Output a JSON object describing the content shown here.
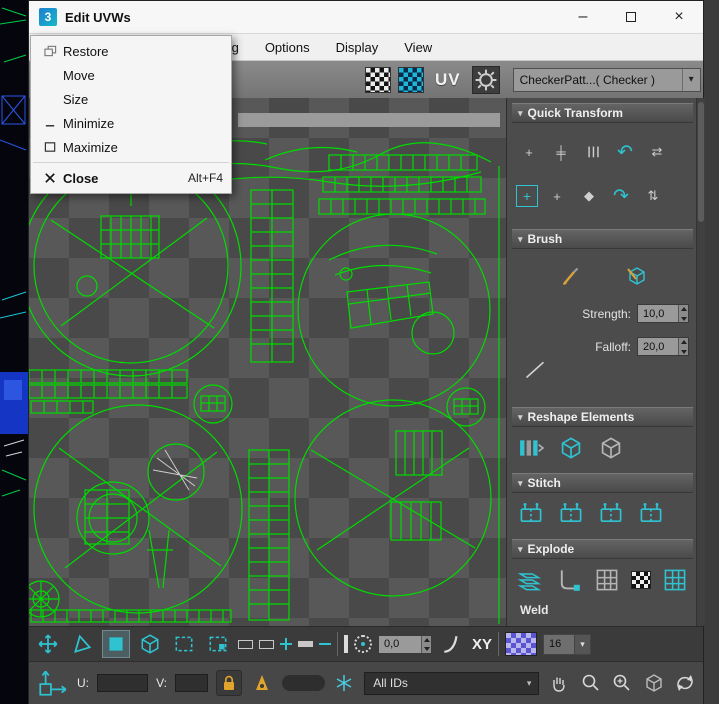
{
  "window": {
    "title": "Edit UVWs",
    "logo_text": "3",
    "controls": {
      "minimize": "–",
      "close": "×"
    },
    "menu_bar": [
      "pping",
      "Options",
      "Display",
      "View"
    ],
    "toolbar": {
      "uv_label": "UV",
      "texture_dropdown": "CheckerPatt...( Checker )"
    }
  },
  "system_menu": {
    "items": [
      {
        "label": "Restore",
        "shortcut": ""
      },
      {
        "label": "Move",
        "shortcut": ""
      },
      {
        "label": "Size",
        "shortcut": ""
      },
      {
        "label": "Minimize",
        "shortcut": ""
      },
      {
        "label": "Maximize",
        "shortcut": ""
      },
      {
        "label": "Close",
        "shortcut": "Alt+F4"
      }
    ]
  },
  "panel": {
    "quick_transform_title": "Quick Transform",
    "brush_title": "Brush",
    "strength_label": "Strength:",
    "strength_value": "10,0",
    "falloff_label": "Falloff:",
    "falloff_value": "20,0",
    "reshape_title": "Reshape Elements",
    "stitch_title": "Stitch",
    "explode_title": "Explode",
    "weld_label": "Weld"
  },
  "bottom_toolbar": {
    "coord_value": "0,0",
    "xy_label": "XY",
    "grid_size": "16"
  },
  "status_bar": {
    "u_label": "U:",
    "v_label": "V:",
    "all_ids_value": "All IDs"
  },
  "colors": {
    "accent": "#2fc3d2",
    "wireframe": "#00dc00",
    "gold": "#d9a33a"
  },
  "icons": {
    "dropdown": "▾",
    "section_arrow": "▾",
    "plus": "+",
    "align": "╪",
    "bars": "┃┃┃",
    "rotate_ccw": "↶",
    "rotate_cw": "↷",
    "diamond": "◆",
    "swap_h": "⇄",
    "swap_v": "⇅"
  }
}
